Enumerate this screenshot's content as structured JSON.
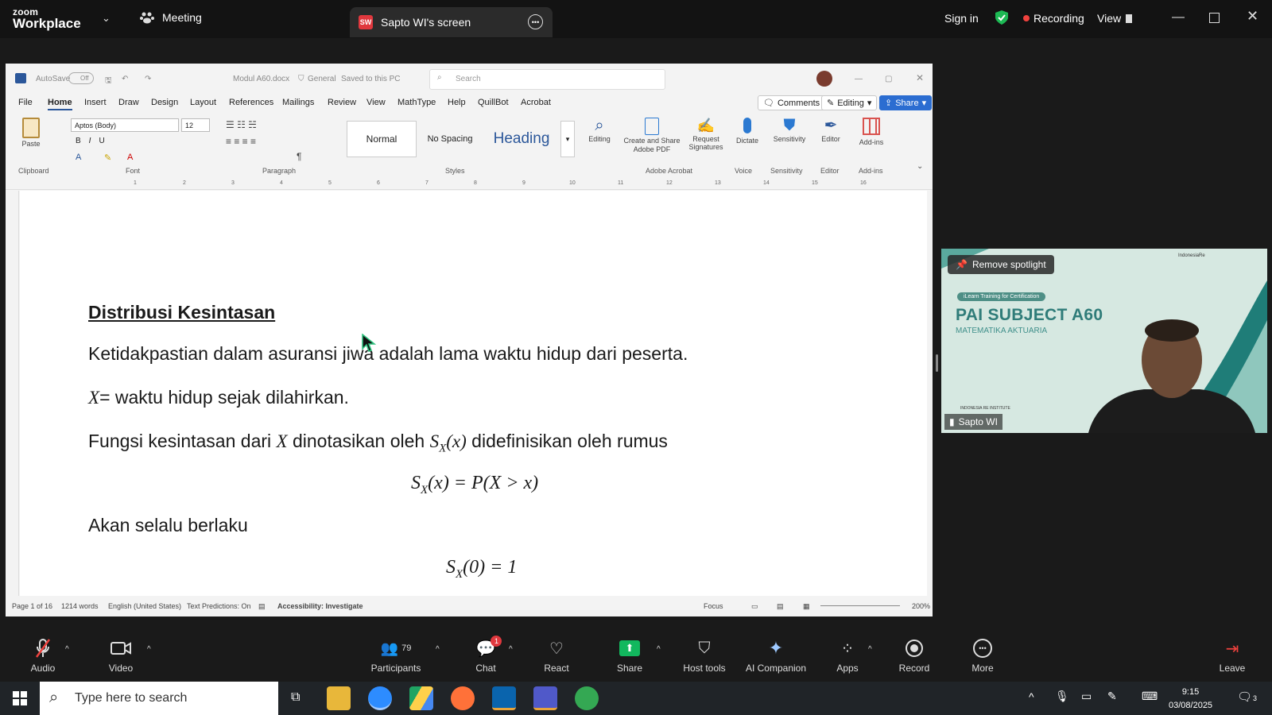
{
  "zoom": {
    "logo_line1": "zoom",
    "logo_line2": "Workplace",
    "meeting_tab": "Meeting",
    "share_badge": "SW",
    "share_tab": "Sapto WI's screen",
    "sign_in": "Sign in",
    "recording": "Recording",
    "view": "View"
  },
  "word": {
    "autosave_label": "AutoSave",
    "autosave_state": "Off",
    "doc_title": "Modul A60.docx",
    "sensitivity_label": "General",
    "save_state": "Saved to this PC",
    "search_placeholder": "Search",
    "menu": [
      "File",
      "Home",
      "Insert",
      "Draw",
      "Design",
      "Layout",
      "References",
      "Mailings",
      "Review",
      "View",
      "MathType",
      "Help",
      "QuillBot",
      "Acrobat"
    ],
    "comments_btn": "Comments",
    "editing_btn": "Editing",
    "share_btn": "Share",
    "ribbon": {
      "paste": "Paste",
      "clipboard": "Clipboard",
      "font_name": "Aptos (Body)",
      "font_size": "12",
      "font_group": "Font",
      "paragraph_group": "Paragraph",
      "styles_group": "Styles",
      "styles": [
        "Normal",
        "No Spacing",
        "Heading"
      ],
      "editing": "Editing",
      "create_share_pdf": "Create and Share Adobe PDF",
      "request_signatures": "Request Signatures",
      "adobe_group": "Adobe Acrobat",
      "dictate": "Dictate",
      "voice_group": "Voice",
      "sensitivity": "Sensitivity",
      "sensitivity_group": "Sensitivity",
      "editor": "Editor",
      "editor_group": "Editor",
      "addins": "Add-ins",
      "addins_group": "Add-ins"
    },
    "ruler_ticks": [
      "1",
      "2",
      "3",
      "4",
      "5",
      "6",
      "7",
      "8",
      "9",
      "10",
      "11",
      "12",
      "13",
      "14",
      "15",
      "16"
    ],
    "doc": {
      "heading": "Distribusi Kesintasan",
      "p1": "Ketidakpastian dalam asuransi jiwa adalah lama waktu hidup dari peserta.",
      "p2_var": "X",
      "p2_text": "= waktu hidup sejak dilahirkan.",
      "p3_a": "Fungsi kesintasan dari ",
      "p3_var": "X",
      "p3_b": " dinotasikan oleh ",
      "p3_sym": "S",
      "p3_sub": "X",
      "p3_arg": "(x)",
      "p3_c": " didefinisikan oleh rumus",
      "eq1_s": "S",
      "eq1_sub": "X",
      "eq1_rest": "(x) = P(X > x)",
      "p4": "Akan selalu berlaku",
      "eq2_s": "S",
      "eq2_sub": "X",
      "eq2_rest": "(0) = 1"
    },
    "status": {
      "page": "Page 1 of 16",
      "words": "1214 words",
      "language": "English (United States)",
      "predictions": "Text Predictions: On",
      "accessibility": "Accessibility: Investigate",
      "focus": "Focus",
      "zoom": "200%"
    }
  },
  "video": {
    "remove_spotlight": "Remove spotlight",
    "banner": "iLearn Training for Certification",
    "title": "PAI SUBJECT A60",
    "subtitle": "MATEMATIKA AKTUARIA",
    "logo_text": "IndonesiaRe",
    "footer": "INDONESIA RE INSTITUTE",
    "participant": "Sapto WI"
  },
  "toolbar": {
    "audio": "Audio",
    "video": "Video",
    "participants": "Participants",
    "participants_count": "79",
    "chat": "Chat",
    "chat_badge": "1",
    "react": "React",
    "share": "Share",
    "host_tools": "Host tools",
    "ai_companion": "AI Companion",
    "apps": "Apps",
    "record": "Record",
    "more": "More",
    "leave": "Leave"
  },
  "taskbar": {
    "search_placeholder": "Type here to search",
    "time": "9:15",
    "date": "03/08/2025",
    "notif_count": "3"
  },
  "colors": {
    "zoom_bg": "#1a1a1a",
    "word_accent": "#2b579a",
    "share_green": "#12b85e",
    "record_red": "#f0423e",
    "slide_teal": "#2f7c79"
  }
}
